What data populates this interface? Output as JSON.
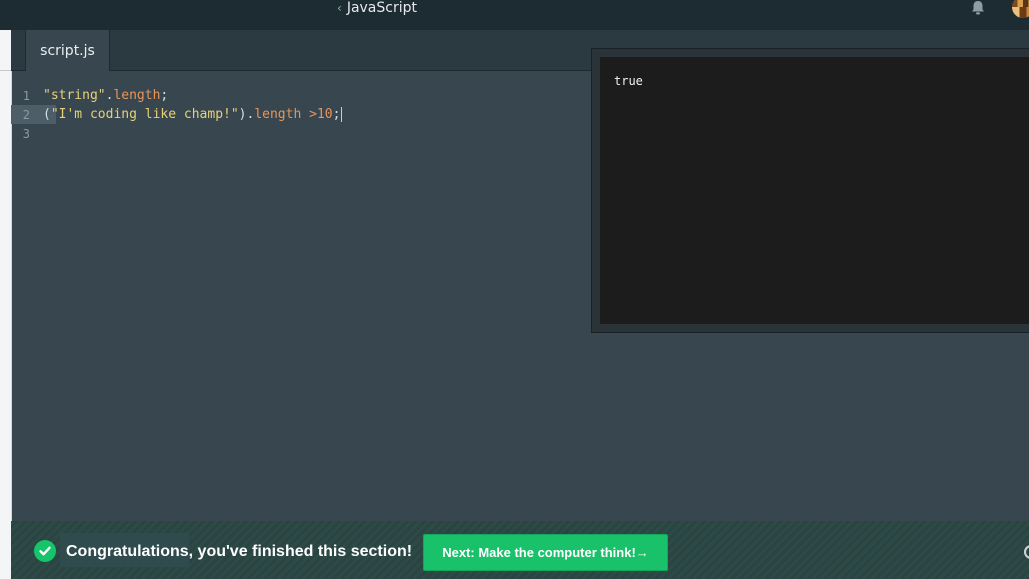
{
  "header": {
    "back_chevron": "‹",
    "course_title": "JavaScript",
    "icons": {
      "notifications": "bell-icon",
      "user": "avatar"
    }
  },
  "tabs": [
    {
      "label": "script.js",
      "active": true
    }
  ],
  "editor": {
    "line_numbers": [
      "1",
      "2",
      "3"
    ],
    "active_line": 2,
    "lines": [
      "\"string\".length;",
      "(\"I'm coding like champ!\").length >10;",
      ""
    ]
  },
  "output": {
    "text": "true"
  },
  "footer": {
    "status_icon": "check-circle-icon",
    "message": "Congratulations, you've finished this section!",
    "next_button": "Next: Make the computer think!→"
  },
  "colors": {
    "topbar": "#1d2b33",
    "editor_bg": "#38474f",
    "output_bg": "#1c1c1d",
    "accent_green": "#19c16a",
    "string": "#e8d07a",
    "keyword": "#e8955a"
  }
}
